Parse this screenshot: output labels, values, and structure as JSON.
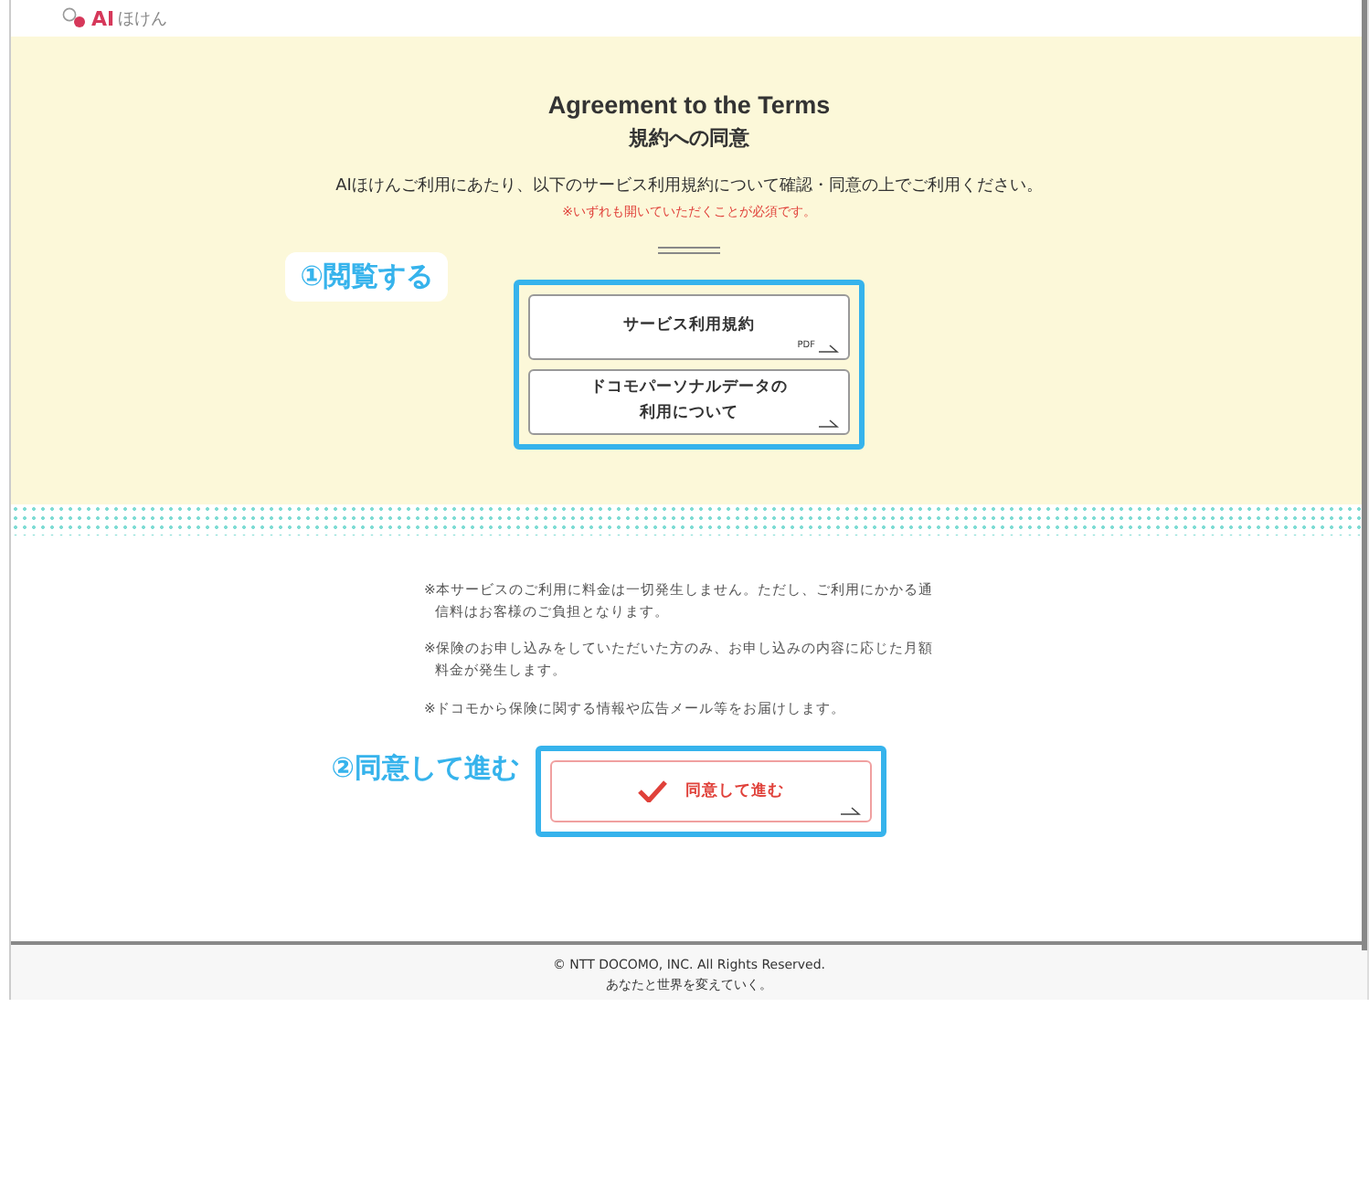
{
  "logo": {
    "brand": "AI",
    "name": "ほけん"
  },
  "title": "Agreement to the Terms",
  "subtitle": "規約への同意",
  "intro": "AIほけんご利用にあたり、以下のサービス利用規約について確認・同意の上でご利用ください。",
  "required_note": "※いずれも開いていただくことが必須です。",
  "step1_label": "①閲覧する",
  "documents": [
    {
      "lines": [
        "サービス利用規約"
      ],
      "badge": "PDF"
    },
    {
      "lines": [
        "ドコモパーソナルデータの",
        "利用について"
      ]
    }
  ],
  "notes": [
    [
      "※本サービスのご利用に料金は一切発生しません。ただし、ご利用にかかる通",
      "信料はお客様のご負担となります。"
    ],
    [
      "※保険のお申し込みをしていただいた方のみ、お申し込みの内容に応じた月額",
      "料金が発生します。"
    ],
    [
      "※ドコモから保険に関する情報や広告メール等をお届けします。"
    ]
  ],
  "step2_label": "②同意して進む",
  "agree_button": "同意して進む",
  "footer": {
    "copyright": "© NTT DOCOMO, INC. All Rights Reserved.",
    "tagline": "あなたと世界を変えていく。"
  }
}
